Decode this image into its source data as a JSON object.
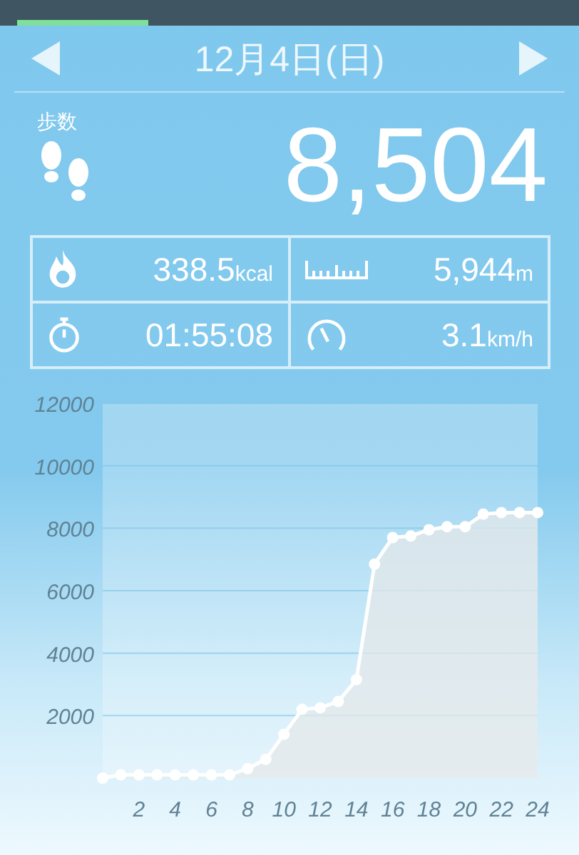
{
  "tabs": [
    {
      "selected": true
    },
    {
      "selected": false
    },
    {
      "selected": false
    },
    {
      "selected": false
    }
  ],
  "date_nav": {
    "date": "12月4日(日)"
  },
  "steps": {
    "label": "歩数",
    "value": "8,504"
  },
  "stats": [
    {
      "kind": "calories",
      "value": "338.5",
      "unit": "kcal"
    },
    {
      "kind": "distance",
      "value": "5,944",
      "unit": "m"
    },
    {
      "kind": "time",
      "value": "01:55:08"
    },
    {
      "kind": "speed",
      "value": "3.1",
      "unit": "km/h"
    }
  ],
  "chart": {
    "chart_data": {
      "type": "area",
      "x": [
        0,
        1,
        2,
        3,
        4,
        5,
        6,
        7,
        8,
        9,
        10,
        11,
        12,
        13,
        14,
        15,
        16,
        17,
        18,
        19,
        20,
        21,
        22,
        23,
        24
      ],
      "series": [
        {
          "color": "#ffffff",
          "values": [
            0,
            100,
            100,
            100,
            100,
            100,
            100,
            100,
            300,
            600,
            1400,
            2200,
            2250,
            2450,
            3150,
            6850,
            7700,
            7750,
            7950,
            8050,
            8050,
            8450,
            8500,
            8500,
            8500
          ]
        }
      ],
      "grid": true,
      "xlim": [
        0,
        24
      ],
      "ylim": [
        0,
        12000
      ],
      "xticks": [
        2,
        4,
        6,
        8,
        10,
        12,
        14,
        16,
        18,
        20,
        22,
        24
      ],
      "yticks": [
        2000,
        4000,
        6000,
        8000,
        10000,
        12000
      ]
    }
  }
}
